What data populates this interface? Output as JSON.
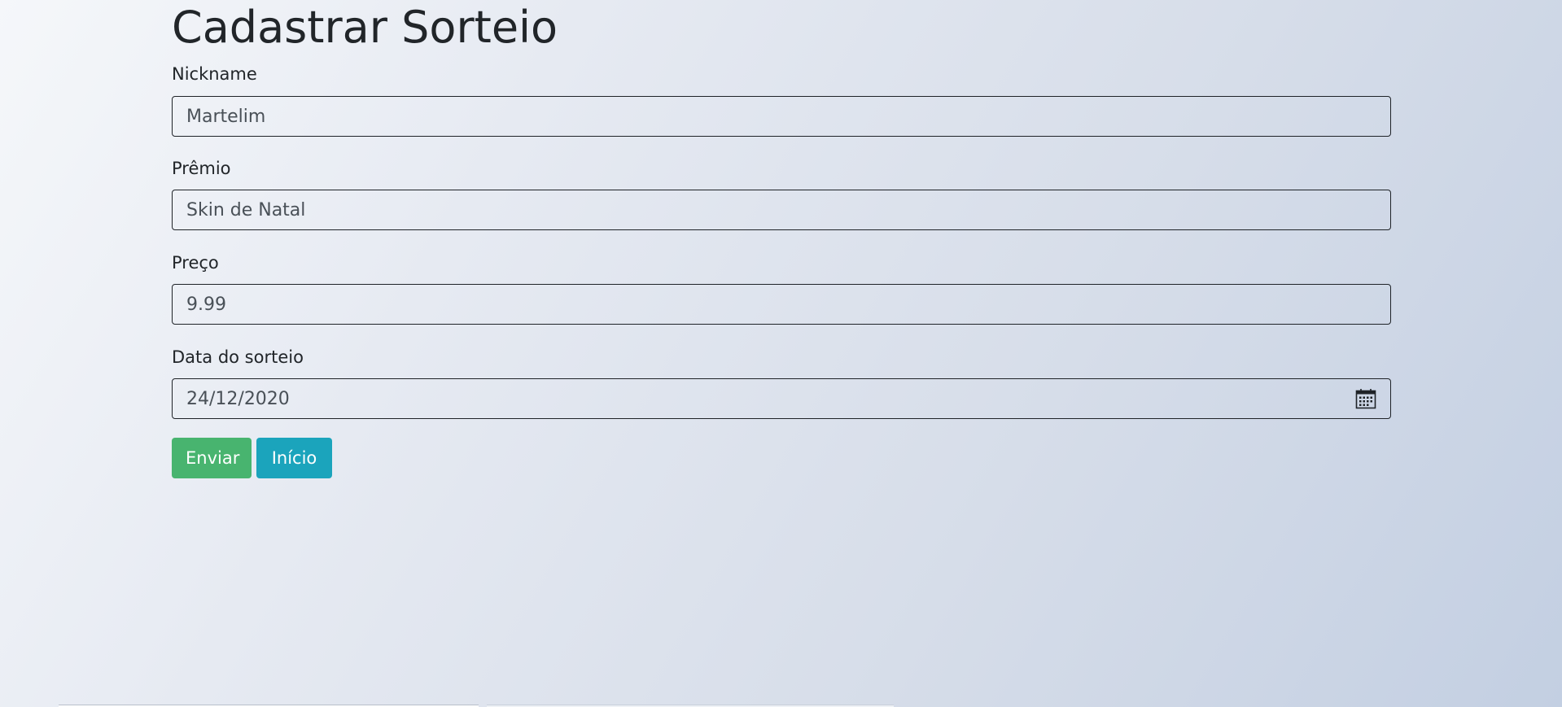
{
  "page": {
    "title": "Cadastrar Sorteio"
  },
  "form": {
    "nickname": {
      "label": "Nickname",
      "value": "Martelim"
    },
    "premio": {
      "label": "Prêmio",
      "value": "Skin de Natal"
    },
    "preco": {
      "label": "Preço",
      "value": "9.99"
    },
    "data_sorteio": {
      "label": "Data do sorteio",
      "value": "24/12/2020",
      "icon": "calendar-icon"
    }
  },
  "buttons": {
    "submit_label": "Enviar",
    "home_label": "Início"
  },
  "colors": {
    "submit": "#48b46f",
    "home": "#1ba4bc",
    "text": "#212529",
    "input_text": "#495057"
  }
}
